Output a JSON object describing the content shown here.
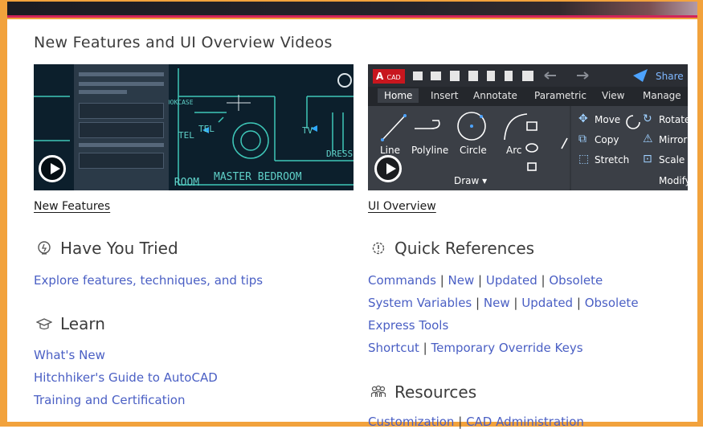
{
  "page": {
    "title": "New Features and UI Overview Videos"
  },
  "videos": [
    {
      "label": "New Features"
    },
    {
      "label": "UI Overview"
    }
  ],
  "thumb1": {
    "labels": [
      "TEL",
      "TEL",
      "TV",
      "MASTER BEDROOM",
      "LIVING ROOM",
      "BOOKCASE",
      "DRESSING"
    ]
  },
  "thumb2": {
    "logo": "A",
    "logo_small": "CAD",
    "share": "Share",
    "tabs": [
      "Home",
      "Insert",
      "Annotate",
      "Parametric",
      "View",
      "Manage"
    ],
    "draw_tools": [
      "Line",
      "Polyline",
      "Circle",
      "Arc"
    ],
    "draw_group": "Draw ▾",
    "modify_tools": [
      "Move",
      "Copy",
      "Stretch",
      "Rotate",
      "Mirror",
      "Scale"
    ],
    "modify_group": "Modify"
  },
  "have_you_tried": {
    "heading": "Have You Tried",
    "links": [
      "Explore features, techniques, and tips"
    ]
  },
  "learn": {
    "heading": "Learn",
    "links": [
      "What's New",
      "Hitchhiker's Guide to AutoCAD",
      "Training and Certification"
    ]
  },
  "quick_references": {
    "heading": "Quick References",
    "rows": [
      [
        "Commands",
        "New",
        "Updated",
        "Obsolete"
      ],
      [
        "System Variables",
        "New",
        "Updated",
        "Obsolete"
      ],
      [
        "Express Tools"
      ],
      [
        "Shortcut",
        "Temporary Override Keys"
      ]
    ]
  },
  "resources": {
    "heading": "Resources",
    "links": [
      "Customization",
      "CAD Administration"
    ]
  },
  "colors": {
    "frame": "#f2a23c",
    "accent": "#d2245a",
    "link": "#4a5fc4"
  }
}
